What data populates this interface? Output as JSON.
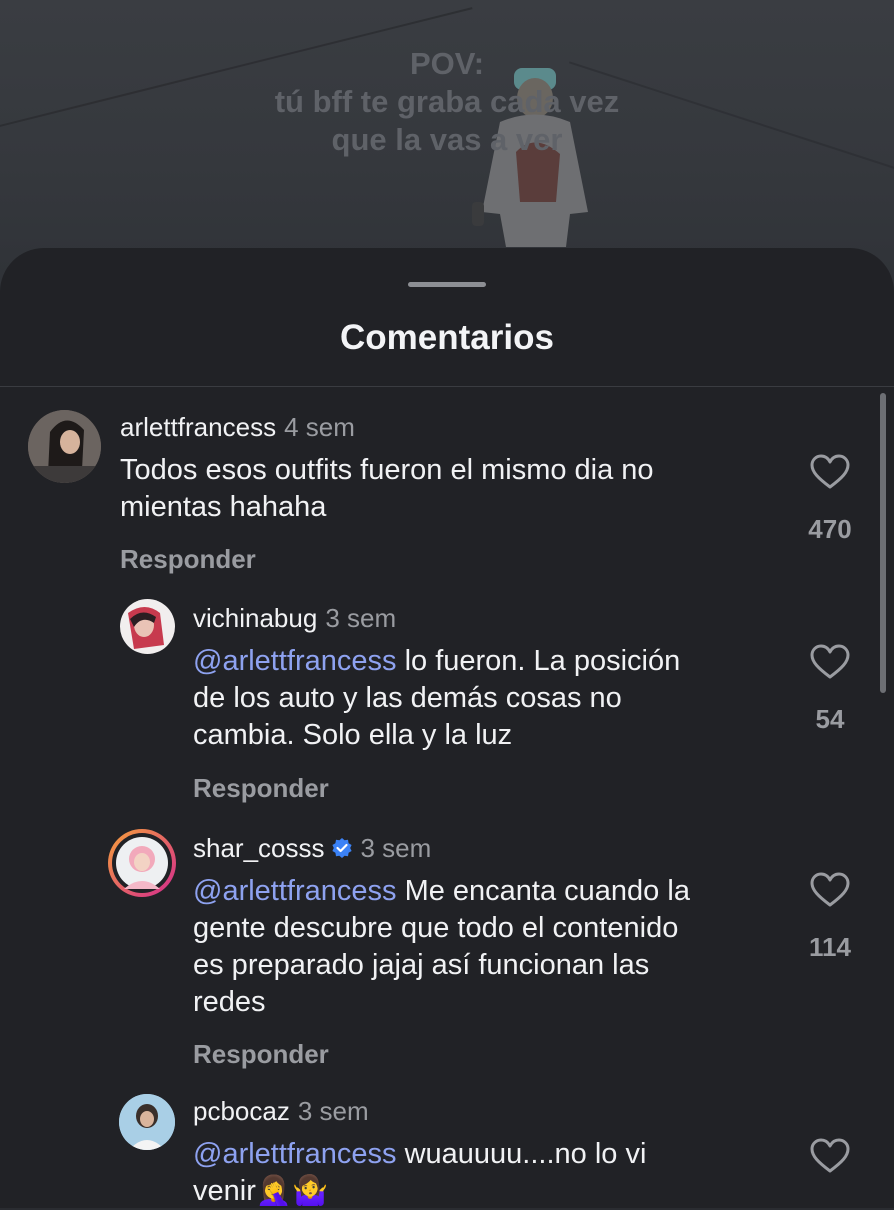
{
  "video": {
    "overlay_lines": [
      "POV:",
      "tú bff te graba cada vez",
      "que la vas a ver"
    ]
  },
  "sheet": {
    "title": "Comentarios"
  },
  "comments": [
    {
      "username": "arlettfrancess",
      "time": "4 sem",
      "mention": "",
      "text_lines": [
        "Todos esos outfits fueron el mismo dia no",
        "mientas hahaha"
      ],
      "likes": "470",
      "reply_label": "Responder",
      "verified": false
    },
    {
      "username": "vichinabug",
      "time": "3 sem",
      "mention": "@arlettfrancess",
      "text_lines": [
        " lo fueron. La posición",
        "de los auto y las demás cosas no",
        "cambia. Solo ella y la luz"
      ],
      "likes": "54",
      "reply_label": "Responder",
      "verified": false
    },
    {
      "username": "shar_cosss",
      "time": "3 sem",
      "mention": "@arlettfrancess",
      "text_lines": [
        " Me encanta cuando la",
        "gente descubre que todo el contenido",
        "es preparado jajaj así funcionan las",
        "redes"
      ],
      "likes": "114",
      "reply_label": "Responder",
      "verified": true
    },
    {
      "username": "pcbocaz",
      "time": "3 sem",
      "mention": "@arlettfrancess",
      "text_lines": [
        " wuauuuu....no lo vi",
        "venir🤦‍♀️🤷‍♀️"
      ],
      "likes": "",
      "reply_label": "",
      "verified": false
    }
  ],
  "colors": {
    "mention": "#8ea2f0",
    "story_ring_start": "#f6a13a",
    "story_ring_end": "#d42a8e",
    "verified_badge": "#3b82f6"
  }
}
